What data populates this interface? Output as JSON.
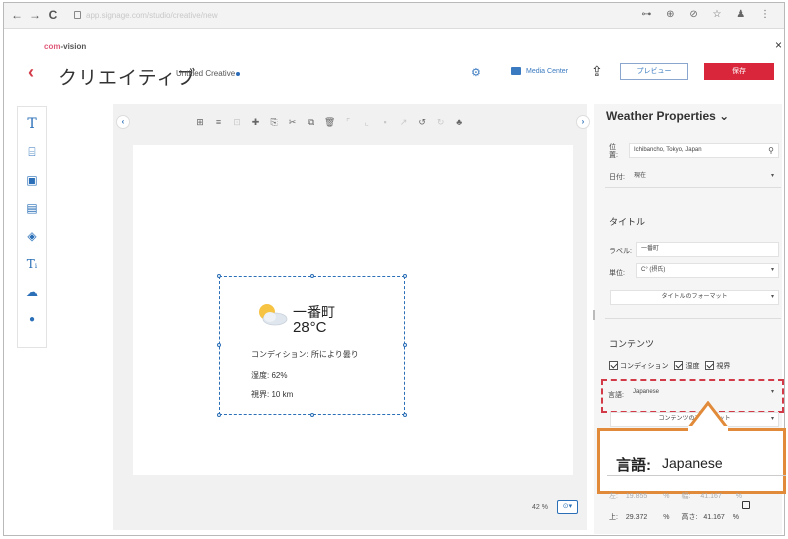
{
  "browser": {
    "back": "←",
    "forward": "→",
    "reload": "C",
    "url": "app.signage.com/studio/creative/new",
    "icons": "⊶ ⊕ ⊘ ☆ ♟ ⋮"
  },
  "header": {
    "logo_prefix": "com",
    "logo_suffix": "-vision",
    "back_glyph": "‹",
    "title": "クリエイティブ",
    "creative_name": "Untitled Creative",
    "media_center": "Media Center",
    "preview": "プレビュー",
    "save": "保存",
    "close": "×"
  },
  "tools": [
    {
      "name": "text-tool-icon",
      "glyph": "T"
    },
    {
      "name": "text-frame-tool-icon",
      "glyph": "⌸"
    },
    {
      "name": "image-tool-icon",
      "glyph": "▣"
    },
    {
      "name": "video-tool-icon",
      "glyph": "▤"
    },
    {
      "name": "shapes-tool-icon",
      "glyph": "◈"
    },
    {
      "name": "ticker-text-tool-icon",
      "glyph": "Tᵢ"
    },
    {
      "name": "weather-tool-icon",
      "glyph": "☁"
    },
    {
      "name": "clock-tool-icon",
      "glyph": "●"
    }
  ],
  "toolbar": {
    "items": [
      "⊞",
      "≡",
      "⊡",
      "✚",
      "⎘",
      "✂",
      "⧉",
      "🗑",
      "⌜",
      "⌞",
      "▪",
      "↗",
      "↺",
      "↻",
      "♣"
    ]
  },
  "widget": {
    "location": "一番町",
    "temperature": "28°C",
    "condition": "コンディション: 所により曇り",
    "humidity": "湿度: 62%",
    "visibility": "視界: 10 km"
  },
  "canvas": {
    "zoom": "42 %",
    "zoom_btn": "⊙▾"
  },
  "properties": {
    "title": "Weather Properties",
    "title_chevron": "⌄",
    "location_label": "位置:",
    "location_value": "Ichibancho, Tokyo, Japan",
    "date_label": "日付:",
    "date_value": "現在",
    "title_section": "タイトル",
    "label_label": "ラベル:",
    "label_value": "一番町",
    "unit_label": "単位:",
    "unit_value": "C° (摂氏)",
    "title_format": "タイトルのフォーマット",
    "content_section": "コンテンツ",
    "checkboxes": [
      "コンディション",
      "湿度",
      "視界"
    ],
    "language_label": "言語:",
    "language_value": "Japanese",
    "content_format": "コンテンツのフォーマット",
    "left_label": "左:",
    "left_value": "19.855",
    "width_label": "幅:",
    "width_value": "41.167",
    "top_label": "上:",
    "top_value": "29.372",
    "height_label": "高さ:",
    "height_value": "41.167",
    "percent": "%"
  },
  "callout": {
    "label": "言語:",
    "value": "Japanese"
  },
  "colors": {
    "accent": "#2a6fb7",
    "brand_red": "#d9263a",
    "callout_orange": "#e08a3a"
  }
}
